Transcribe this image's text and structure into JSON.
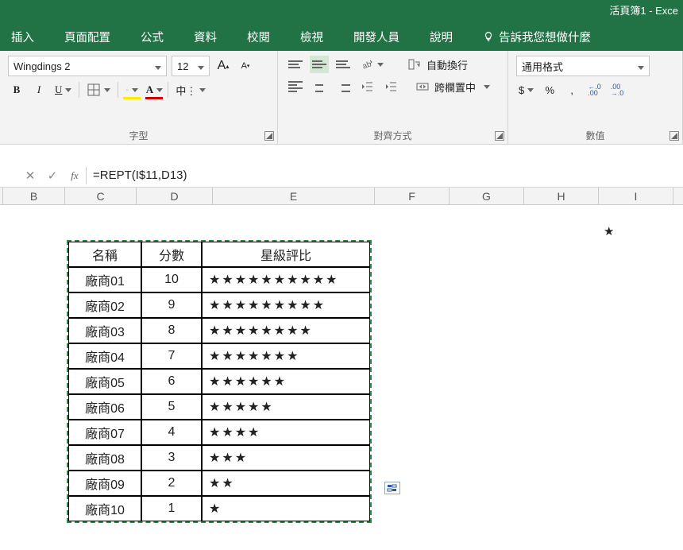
{
  "title": "活頁簿1  -  Exce",
  "tabs": {
    "insert": "插入",
    "layout": "頁面配置",
    "formulas": "公式",
    "data": "資料",
    "review": "校閱",
    "view": "檢視",
    "developer": "開發人員",
    "help": "說明",
    "tellme": "告訴我您想做什麼"
  },
  "ribbon": {
    "font": {
      "name": "Wingdings 2",
      "size": "12",
      "group_label": "字型",
      "phonetic": "中⋮"
    },
    "align": {
      "wrap": "自動換行",
      "merge": "跨欄置中",
      "group_label": "對齊方式"
    },
    "number": {
      "format": "通用格式",
      "group_label": "數值",
      "currency": "$",
      "percent": "%",
      "comma": ",",
      "inc": ".0\n.00",
      "dec": ".00\n.0"
    }
  },
  "formula_bar": {
    "fx": "fx",
    "value": "=REPT(I$11,D13)"
  },
  "columns": [
    "B",
    "C",
    "D",
    "E",
    "F",
    "G",
    "H",
    "I"
  ],
  "star_src": "★",
  "table": {
    "headers": {
      "name": "名稱",
      "score": "分數",
      "stars": "星級評比"
    },
    "rows": [
      {
        "name": "廠商01",
        "score": 10,
        "stars": "★★★★★★★★★★"
      },
      {
        "name": "廠商02",
        "score": 9,
        "stars": "★★★★★★★★★"
      },
      {
        "name": "廠商03",
        "score": 8,
        "stars": "★★★★★★★★"
      },
      {
        "name": "廠商04",
        "score": 7,
        "stars": "★★★★★★★"
      },
      {
        "name": "廠商05",
        "score": 6,
        "stars": "★★★★★★"
      },
      {
        "name": "廠商06",
        "score": 5,
        "stars": "★★★★★"
      },
      {
        "name": "廠商07",
        "score": 4,
        "stars": "★★★★"
      },
      {
        "name": "廠商08",
        "score": 3,
        "stars": "★★★"
      },
      {
        "name": "廠商09",
        "score": 2,
        "stars": "★★"
      },
      {
        "name": "廠商10",
        "score": 1,
        "stars": "★"
      }
    ]
  },
  "chart_data": {
    "type": "table",
    "title": "星級評比",
    "columns": [
      "名稱",
      "分數",
      "星級評比"
    ],
    "rows": [
      [
        "廠商01",
        10,
        "★★★★★★★★★★"
      ],
      [
        "廠商02",
        9,
        "★★★★★★★★★"
      ],
      [
        "廠商03",
        8,
        "★★★★★★★★"
      ],
      [
        "廠商04",
        7,
        "★★★★★★★"
      ],
      [
        "廠商05",
        6,
        "★★★★★★"
      ],
      [
        "廠商06",
        5,
        "★★★★★"
      ],
      [
        "廠商07",
        4,
        "★★★★"
      ],
      [
        "廠商08",
        3,
        "★★★"
      ],
      [
        "廠商09",
        2,
        "★★"
      ],
      [
        "廠商10",
        1,
        "★"
      ]
    ]
  }
}
